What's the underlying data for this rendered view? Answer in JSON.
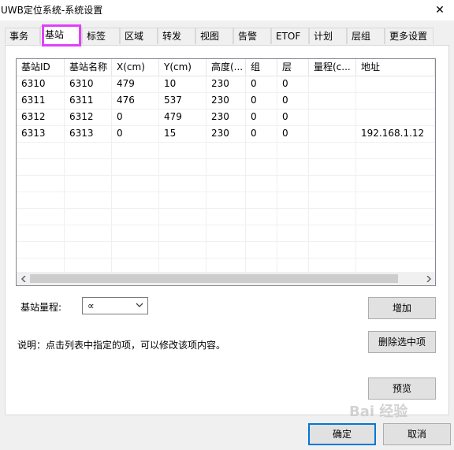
{
  "window": {
    "title": "UWB定位系统-系统设置",
    "close_glyph": "✕"
  },
  "tabs": [
    "事务",
    "基站",
    "标签",
    "区域",
    "转发",
    "视图",
    "告警",
    "ETOF",
    "计划",
    "层组",
    "更多设置"
  ],
  "selected_tab": "基站",
  "table": {
    "columns": [
      "基站ID",
      "基站名称",
      "X(cm)",
      "Y(cm)",
      "高度(...",
      "组",
      "层",
      "量程(c...",
      "地址"
    ],
    "rows": [
      [
        "6310",
        "6310",
        "479",
        "10",
        "230",
        "0",
        "0",
        "",
        ""
      ],
      [
        "6311",
        "6311",
        "476",
        "537",
        "230",
        "0",
        "0",
        "",
        ""
      ],
      [
        "6312",
        "6312",
        "0",
        "479",
        "230",
        "0",
        "0",
        "",
        ""
      ],
      [
        "6313",
        "6313",
        "0",
        "15",
        "230",
        "0",
        "0",
        "",
        "192.168.1.12"
      ]
    ]
  },
  "range_label": "基站量程:",
  "range_value": "∝",
  "note": "说明：点击列表中指定的项，可以修改该项内容。",
  "buttons": {
    "add": "增加",
    "delete": "删除选中项",
    "preview": "预览",
    "ok": "确定",
    "cancel": "取消"
  },
  "watermark": "Bai 经验"
}
